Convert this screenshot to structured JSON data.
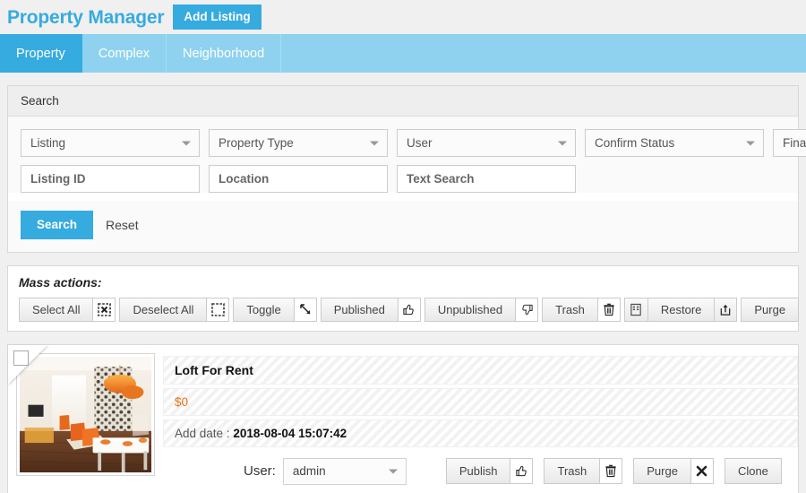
{
  "header": {
    "title": "Property Manager",
    "add_button": "Add Listing",
    "accent_color": "#35abe0"
  },
  "tabs": [
    {
      "label": "Property",
      "active": true
    },
    {
      "label": "Complex",
      "active": false
    },
    {
      "label": "Neighborhood",
      "active": false
    }
  ],
  "search": {
    "panel_title": "Search",
    "selects": [
      {
        "label": "Listing"
      },
      {
        "label": "Property Type"
      },
      {
        "label": "User"
      },
      {
        "label": "Confirm Status"
      },
      {
        "label": "Fina"
      }
    ],
    "inputs": [
      {
        "placeholder": "Listing ID"
      },
      {
        "placeholder": "Location"
      },
      {
        "placeholder": "Text Search"
      }
    ],
    "search_button": "Search",
    "reset_link": "Reset"
  },
  "mass_actions": {
    "label": "Mass actions:",
    "buttons": [
      {
        "label": "Select All",
        "icon": "select-all-icon"
      },
      {
        "label": "Deselect All",
        "icon": "deselect-all-icon"
      },
      {
        "label": "Toggle",
        "icon": "toggle-icon"
      },
      {
        "label": "Published",
        "icon": "thumbs-up-icon"
      },
      {
        "label": "Unpublished",
        "icon": "thumbs-down-icon"
      },
      {
        "label": "Trash",
        "icon": "trash-icon"
      },
      {
        "label": "Restore",
        "icon": "restore-icon"
      },
      {
        "label": "Purge",
        "icon": "purge-icon"
      }
    ]
  },
  "listing": {
    "title": "Loft For Rent",
    "price": "$0",
    "date_label": "Add date : ",
    "date_value": "2018-08-04 15:07:42",
    "user_label": "User:",
    "user_value": "admin",
    "price_color": "#e8711a",
    "actions": [
      {
        "label": "Publish",
        "icon": "thumbs-up-icon"
      },
      {
        "label": "Trash",
        "icon": "trash-icon"
      },
      {
        "label": "Purge",
        "icon": "x-mark-icon"
      },
      {
        "label": "Clone",
        "icon": "clone-icon"
      }
    ]
  }
}
